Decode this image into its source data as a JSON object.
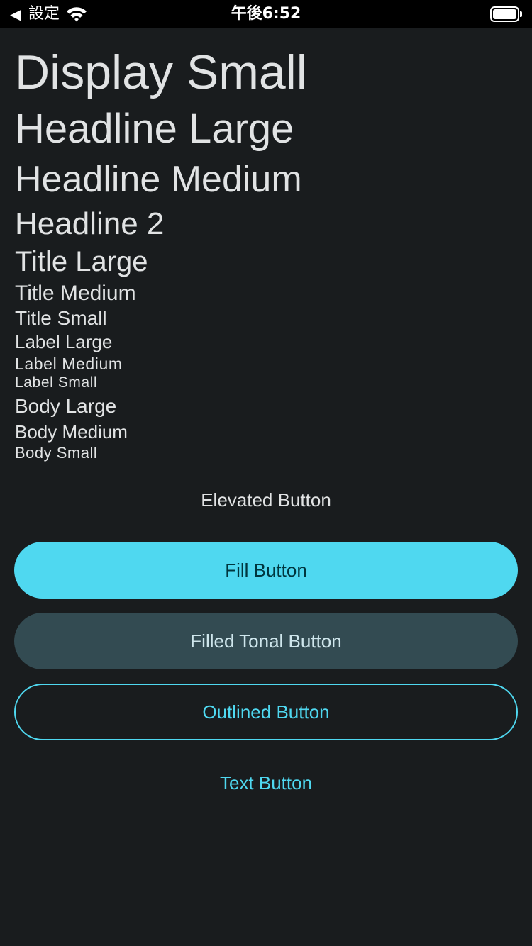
{
  "status_bar": {
    "back_glyph": "◀",
    "carrier": "設定",
    "wifi_icon": "wifi-icon",
    "time": "午後6:52",
    "battery_icon": "battery-icon"
  },
  "typography": {
    "display_small": "Display Small",
    "headline_large": "Headline Large",
    "headline_medium": "Headline Medium",
    "headline_2": "Headline 2",
    "title_large": "Title Large",
    "title_medium": "Title Medium",
    "title_small": "Title Small",
    "label_large": "Label Large",
    "label_medium": "Label Medium",
    "label_small": "Label Small",
    "body_large": "Body Large",
    "body_medium": "Body Medium",
    "body_small": "Body Small"
  },
  "buttons": {
    "elevated": "Elevated Button",
    "fill": "Fill Button",
    "tonal": "Filled Tonal Button",
    "outlined": "Outlined Button",
    "text": "Text Button"
  },
  "colors": {
    "background": "#191c1e",
    "primary": "#4fd8f0",
    "on_primary": "#00363e",
    "tonal_container": "#334b52",
    "on_surface": "#e1e3e4"
  }
}
